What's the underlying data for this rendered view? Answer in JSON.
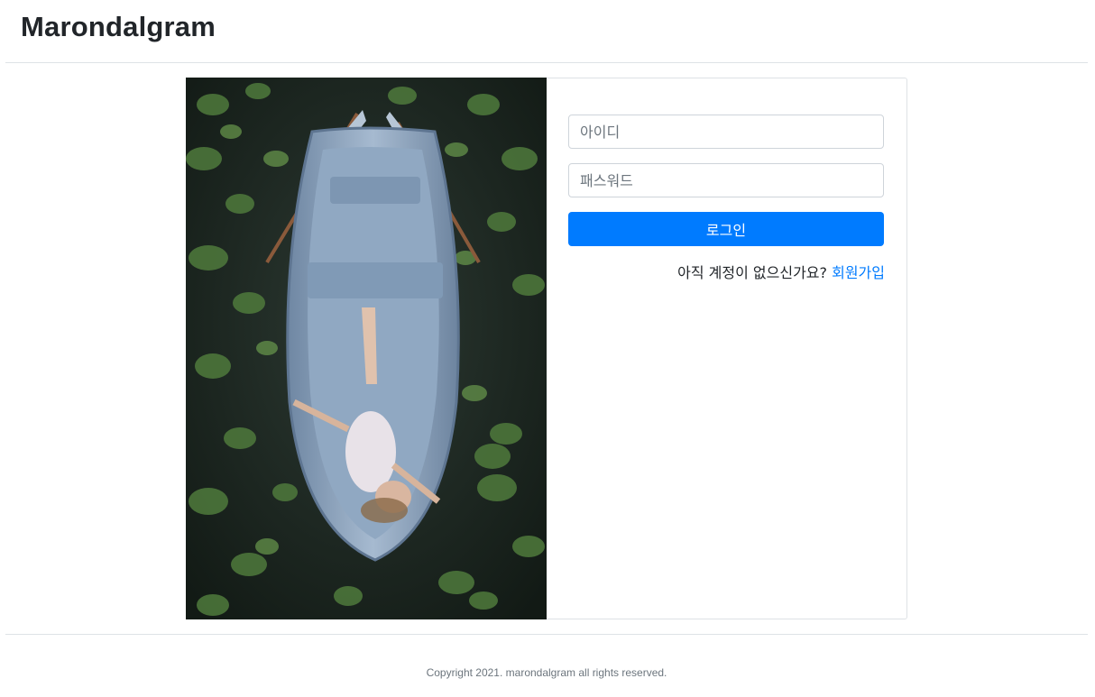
{
  "header": {
    "brand": "Marondalgram"
  },
  "login": {
    "id_placeholder": "아이디",
    "password_placeholder": "패스워드",
    "login_button": "로그인",
    "signup_prompt": "아직 계정이 없으신가요?",
    "signup_link": "회원가입"
  },
  "footer": {
    "copyright": "Copyright 2021. marondalgram all rights reserved."
  },
  "colors": {
    "primary": "#007bff",
    "border": "#dee2e6",
    "text": "#212529",
    "muted": "#6c757d"
  }
}
